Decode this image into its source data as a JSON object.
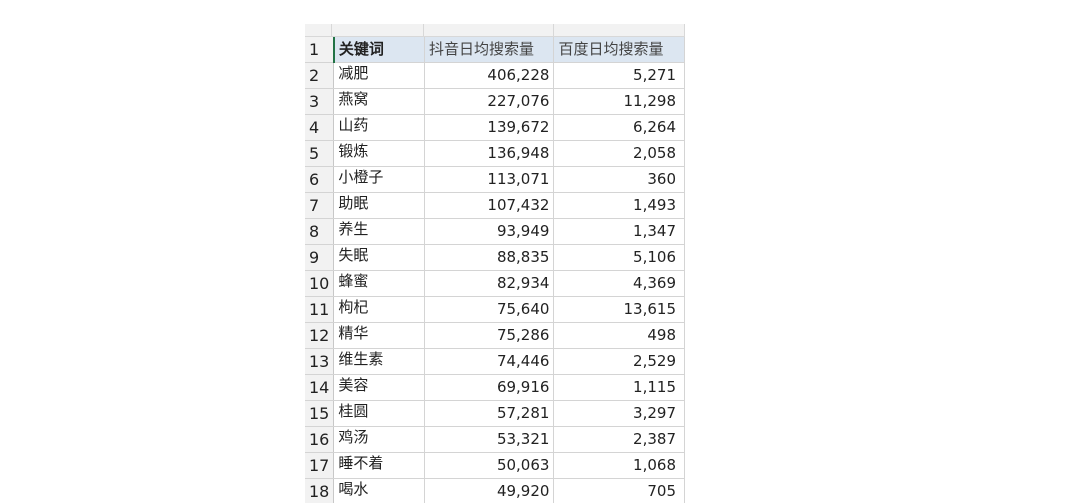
{
  "sheet": {
    "header": {
      "row_number": "1",
      "keyword_label": "关键词",
      "douyin_label": "抖音日均搜索量",
      "baidu_label": "百度日均搜索量"
    },
    "rows": [
      {
        "row": "2",
        "keyword": "减肥",
        "douyin": "406,228",
        "baidu": "5,271"
      },
      {
        "row": "3",
        "keyword": "燕窝",
        "douyin": "227,076",
        "baidu": "11,298"
      },
      {
        "row": "4",
        "keyword": "山药",
        "douyin": "139,672",
        "baidu": "6,264"
      },
      {
        "row": "5",
        "keyword": "锻炼",
        "douyin": "136,948",
        "baidu": "2,058"
      },
      {
        "row": "6",
        "keyword": "小橙子",
        "douyin": "113,071",
        "baidu": "360"
      },
      {
        "row": "7",
        "keyword": "助眠",
        "douyin": "107,432",
        "baidu": "1,493"
      },
      {
        "row": "8",
        "keyword": "养生",
        "douyin": "93,949",
        "baidu": "1,347"
      },
      {
        "row": "9",
        "keyword": "失眠",
        "douyin": "88,835",
        "baidu": "5,106"
      },
      {
        "row": "10",
        "keyword": "蜂蜜",
        "douyin": "82,934",
        "baidu": "4,369"
      },
      {
        "row": "11",
        "keyword": "枸杞",
        "douyin": "75,640",
        "baidu": "13,615"
      },
      {
        "row": "12",
        "keyword": "精华",
        "douyin": "75,286",
        "baidu": "498"
      },
      {
        "row": "13",
        "keyword": "维生素",
        "douyin": "74,446",
        "baidu": "2,529"
      },
      {
        "row": "14",
        "keyword": "美容",
        "douyin": "69,916",
        "baidu": "1,115"
      },
      {
        "row": "15",
        "keyword": "桂圆",
        "douyin": "57,281",
        "baidu": "3,297"
      },
      {
        "row": "16",
        "keyword": "鸡汤",
        "douyin": "53,321",
        "baidu": "2,387"
      },
      {
        "row": "17",
        "keyword": "睡不着",
        "douyin": "50,063",
        "baidu": "1,068"
      },
      {
        "row": "18",
        "keyword": "喝水",
        "douyin": "49,920",
        "baidu": "705"
      }
    ]
  }
}
